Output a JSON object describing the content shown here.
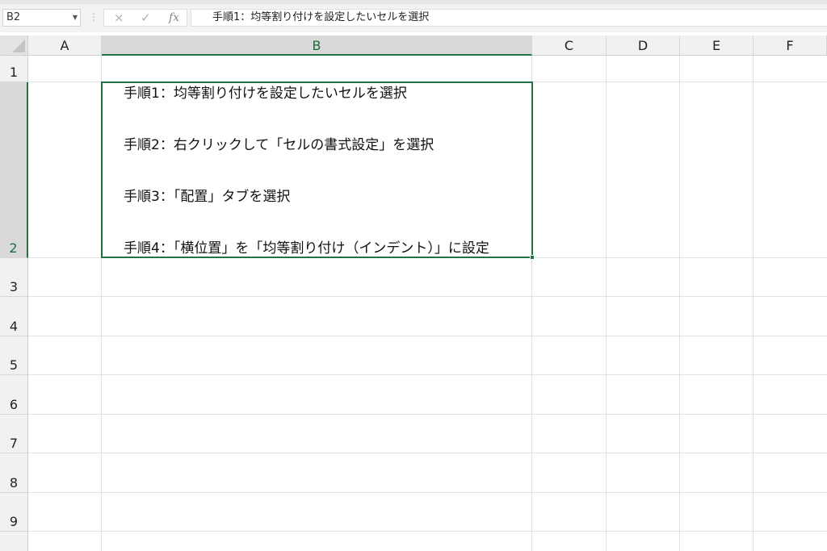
{
  "formula_bar": {
    "name_box": "B2",
    "cancel_icon": "×",
    "enter_icon": "✓",
    "fx_label": "fx",
    "formula": "手順1：均等割り付けを設定したいセルを選択"
  },
  "columns": [
    "A",
    "B",
    "C",
    "D",
    "E",
    "F"
  ],
  "rows": [
    "1",
    "2",
    "3",
    "4",
    "5",
    "6",
    "7",
    "8",
    "9"
  ],
  "selected_cell": "B2",
  "cell_b2_lines": [
    "手順1：均等割り付けを設定したいセルを選択",
    "手順2：右クリックして「セルの書式設定」を選択",
    "手順3：「配置」タブを選択",
    "手順4：「横位置」を「均等割り付け（インデント）」に設定"
  ],
  "colors": {
    "selection": "#217346"
  }
}
